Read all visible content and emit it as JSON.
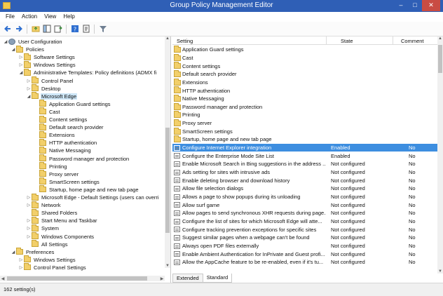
{
  "window": {
    "title": "Group Policy Management Editor"
  },
  "menu": [
    "File",
    "Action",
    "View",
    "Help"
  ],
  "toolbar": {
    "icons": [
      "back-icon",
      "forward-icon",
      "up-folder-icon",
      "show-hide-tree-icon",
      "export-list-icon",
      "help-icon",
      "properties-icon",
      "filter-icon"
    ]
  },
  "tree": [
    {
      "label": "User Configuration",
      "depth": 0,
      "expand": "open",
      "icon": "gear"
    },
    {
      "label": "Policies",
      "depth": 1,
      "expand": "open",
      "icon": "folder"
    },
    {
      "label": "Software Settings",
      "depth": 2,
      "expand": "closed",
      "icon": "folder"
    },
    {
      "label": "Windows Settings",
      "depth": 2,
      "expand": "closed",
      "icon": "folder"
    },
    {
      "label": "Administrative Templates: Policy definitions (ADMX fi",
      "depth": 2,
      "expand": "open",
      "icon": "folder"
    },
    {
      "label": "Control Panel",
      "depth": 3,
      "expand": "closed",
      "icon": "folder"
    },
    {
      "label": "Desktop",
      "depth": 3,
      "expand": "closed",
      "icon": "folder"
    },
    {
      "label": "Microsoft Edge",
      "depth": 3,
      "expand": "open",
      "icon": "folder",
      "selected": true
    },
    {
      "label": "Application Guard settings",
      "depth": 4,
      "expand": "",
      "icon": "folder"
    },
    {
      "label": "Cast",
      "depth": 4,
      "expand": "",
      "icon": "folder"
    },
    {
      "label": "Content settings",
      "depth": 4,
      "expand": "",
      "icon": "folder"
    },
    {
      "label": "Default search provider",
      "depth": 4,
      "expand": "",
      "icon": "folder"
    },
    {
      "label": "Extensions",
      "depth": 4,
      "expand": "",
      "icon": "folder"
    },
    {
      "label": "HTTP authentication",
      "depth": 4,
      "expand": "",
      "icon": "folder"
    },
    {
      "label": "Native Messaging",
      "depth": 4,
      "expand": "",
      "icon": "folder"
    },
    {
      "label": "Password manager and protection",
      "depth": 4,
      "expand": "",
      "icon": "folder"
    },
    {
      "label": "Printing",
      "depth": 4,
      "expand": "",
      "icon": "folder"
    },
    {
      "label": "Proxy server",
      "depth": 4,
      "expand": "",
      "icon": "folder"
    },
    {
      "label": "SmartScreen settings",
      "depth": 4,
      "expand": "",
      "icon": "folder"
    },
    {
      "label": "Startup, home page and new tab page",
      "depth": 4,
      "expand": "",
      "icon": "folder"
    },
    {
      "label": "Microsoft Edge - Default Settings (users can overri",
      "depth": 3,
      "expand": "closed",
      "icon": "folder"
    },
    {
      "label": "Network",
      "depth": 3,
      "expand": "closed",
      "icon": "folder"
    },
    {
      "label": "Shared Folders",
      "depth": 3,
      "expand": "",
      "icon": "folder"
    },
    {
      "label": "Start Menu and Taskbar",
      "depth": 3,
      "expand": "closed",
      "icon": "folder"
    },
    {
      "label": "System",
      "depth": 3,
      "expand": "closed",
      "icon": "folder"
    },
    {
      "label": "Windows Components",
      "depth": 3,
      "expand": "closed",
      "icon": "folder"
    },
    {
      "label": "All Settings",
      "depth": 3,
      "expand": "",
      "icon": "folder"
    },
    {
      "label": "Preferences",
      "depth": 1,
      "expand": "open",
      "icon": "folder"
    },
    {
      "label": "Windows Settings",
      "depth": 2,
      "expand": "closed",
      "icon": "folder"
    },
    {
      "label": "Control Panel Settings",
      "depth": 2,
      "expand": "closed",
      "icon": "folder"
    }
  ],
  "list": {
    "headers": {
      "setting": "Setting",
      "state": "State",
      "comment": "Comment"
    },
    "rows": [
      {
        "setting": "Application Guard settings",
        "state": "",
        "comment": "",
        "icon": "folder"
      },
      {
        "setting": "Cast",
        "state": "",
        "comment": "",
        "icon": "folder"
      },
      {
        "setting": "Content settings",
        "state": "",
        "comment": "",
        "icon": "folder"
      },
      {
        "setting": "Default search provider",
        "state": "",
        "comment": "",
        "icon": "folder"
      },
      {
        "setting": "Extensions",
        "state": "",
        "comment": "",
        "icon": "folder"
      },
      {
        "setting": "HTTP authentication",
        "state": "",
        "comment": "",
        "icon": "folder"
      },
      {
        "setting": "Native Messaging",
        "state": "",
        "comment": "",
        "icon": "folder"
      },
      {
        "setting": "Password manager and protection",
        "state": "",
        "comment": "",
        "icon": "folder"
      },
      {
        "setting": "Printing",
        "state": "",
        "comment": "",
        "icon": "folder"
      },
      {
        "setting": "Proxy server",
        "state": "",
        "comment": "",
        "icon": "folder"
      },
      {
        "setting": "SmartScreen settings",
        "state": "",
        "comment": "",
        "icon": "folder"
      },
      {
        "setting": "Startup, home page and new tab page",
        "state": "",
        "comment": "",
        "icon": "folder"
      },
      {
        "setting": "Configure Internet Explorer integration",
        "state": "Enabled",
        "comment": "No",
        "icon": "policy",
        "selected": true
      },
      {
        "setting": "Configure the Enterprise Mode Site List",
        "state": "Enabled",
        "comment": "No",
        "icon": "policy"
      },
      {
        "setting": "Enable Microsoft Search in Bing suggestions in the address ...",
        "state": "Not configured",
        "comment": "No",
        "icon": "policy"
      },
      {
        "setting": "Ads setting for sites with intrusive ads",
        "state": "Not configured",
        "comment": "No",
        "icon": "policy"
      },
      {
        "setting": "Enable deleting browser and download history",
        "state": "Not configured",
        "comment": "No",
        "icon": "policy"
      },
      {
        "setting": "Allow file selection dialogs",
        "state": "Not configured",
        "comment": "No",
        "icon": "policy"
      },
      {
        "setting": "Allows a page to show popups during its unloading",
        "state": "Not configured",
        "comment": "No",
        "icon": "policy"
      },
      {
        "setting": "Allow surf game",
        "state": "Not configured",
        "comment": "No",
        "icon": "policy"
      },
      {
        "setting": "Allow pages to send synchronous XHR requests during page...",
        "state": "Not configured",
        "comment": "No",
        "icon": "policy"
      },
      {
        "setting": "Configure the list of sites for which Microsoft Edge will atte...",
        "state": "Not configured",
        "comment": "No",
        "icon": "policy"
      },
      {
        "setting": "Configure tracking prevention exceptions for specific sites",
        "state": "Not configured",
        "comment": "No",
        "icon": "policy"
      },
      {
        "setting": "Suggest similar pages when a webpage can't be found",
        "state": "Not configured",
        "comment": "No",
        "icon": "policy"
      },
      {
        "setting": "Always open PDF files externally",
        "state": "Not configured",
        "comment": "No",
        "icon": "policy"
      },
      {
        "setting": "Enable Ambient Authentication for InPrivate and Guest profi...",
        "state": "Not configured",
        "comment": "No",
        "icon": "policy"
      },
      {
        "setting": "Allow the AppCache feature to be re-enabled, even if it's tu...",
        "state": "Not configured",
        "comment": "No",
        "icon": "policy"
      }
    ]
  },
  "tabs": [
    "Extended",
    "Standard"
  ],
  "active_tab": "Standard",
  "status": {
    "text": "162 setting(s)"
  }
}
